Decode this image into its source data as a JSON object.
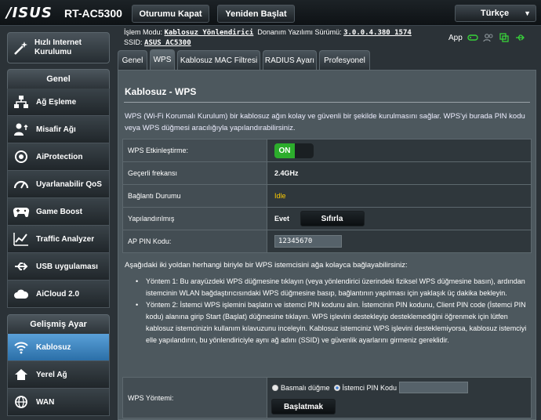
{
  "header": {
    "brand": "/ISUS",
    "model": "RT-AC5300",
    "logout_button": "Oturumu Kapat",
    "reboot_button": "Yeniden Başlat",
    "language": "Türkçe",
    "mode_label": "İşlem Modu:",
    "mode_value": "Kablosuz Yönlendirici",
    "firmware_label": "Donanım Yazılımı Sürümü:",
    "firmware_value": "3.0.0.4.380_1574",
    "ssid_label": "SSID:",
    "ssid_value": "ASUS_AC5300",
    "app_label": "App"
  },
  "sidebar": {
    "quick_setup": "Hızlı Internet Kurulumu",
    "general_title": "Genel",
    "general_items": [
      {
        "label": "Ağ Eşleme",
        "icon": "network-map-icon"
      },
      {
        "label": "Misafir Ağı",
        "icon": "guest-network-icon"
      },
      {
        "label": "AiProtection",
        "icon": "aiprotection-icon"
      },
      {
        "label": "Uyarlanabilir QoS",
        "icon": "qos-icon"
      },
      {
        "label": "Game Boost",
        "icon": "gamepad-icon"
      },
      {
        "label": "Traffic Analyzer",
        "icon": "traffic-analyzer-icon"
      },
      {
        "label": "USB uygulaması",
        "icon": "usb-icon"
      },
      {
        "label": "AiCloud 2.0",
        "icon": "cloud-icon"
      }
    ],
    "advanced_title": "Gelişmiş Ayar",
    "advanced_items": [
      {
        "label": "Kablosuz",
        "icon": "wireless-icon"
      },
      {
        "label": "Yerel Ağ",
        "icon": "lan-icon"
      },
      {
        "label": "WAN",
        "icon": "wan-icon"
      }
    ]
  },
  "tabs": [
    "Genel",
    "WPS",
    "Kablosuz MAC Filtresi",
    "RADIUS Ayarı",
    "Profesyonel"
  ],
  "active_tab": "WPS",
  "panel": {
    "title": "Kablosuz - WPS",
    "description": "WPS (Wi-Fi Korumalı Kurulum) bir kablosuz ağın kolay ve güvenli bir şekilde kurulmasını sağlar. WPS'yi burada PIN kodu veya WPS düğmesi aracılığıyla yapılandırabilirsiniz.",
    "rows": {
      "enable_label": "WPS Etkinleştirme:",
      "enable_value": "ON",
      "freq_label": "Geçerli frekansı",
      "freq_value": "2.4GHz",
      "status_label": "Bağlantı Durumu",
      "status_value": "Idle",
      "configured_label": "Yapılandırılmış",
      "configured_value": "Evet",
      "reset_button": "Sıfırla",
      "pin_label": "AP PIN Kodu:",
      "pin_value": "12345670"
    },
    "intro": "Aşağıdaki iki yoldan herhangi biriyle bir WPS istemcisini ağa kolayca bağlayabilirsiniz:",
    "method1": "Yöntem 1: Bu arayüzdeki WPS düğmesine tıklayın (veya yönlendirici üzerindeki fiziksel WPS düğmesine basın), ardından istemcinin WLAN bağdaştırıcısındaki WPS düğmesine basıp, bağlantının yapılması için yaklaşık üç dakika bekleyin.",
    "method2": "Yöntem 2: İstemci WPS işlemini başlatın ve istemci PIN kodunu alın. İstemcinin PIN kodunu, Client PIN code (İstemci PIN kodu) alanına girip Start (Başlat) düğmesine tıklayın. WPS işlevini destekleyip desteklemediğini öğrenmek için lütfen kablosuz istemcinizin kullanım kılavuzunu inceleyin. Kablosuz istemciniz WPS işlevini desteklemiyorsa, kablosuz istemciyi elle yapılandırın, bu yönlendiriciyle aynı ağ adını (SSID) ve güvenlik ayarlarını girmeniz gereklidir.",
    "wps_method_label": "WPS Yöntemi:",
    "option_push": "Basmalı düğme",
    "option_pin": "İstemci PIN Kodu",
    "start_button": "Başlatmak"
  },
  "colors": {
    "accent_green": "#2cad2c",
    "status_yellow": "#ffcc00",
    "active_blue": "#2b6fa8"
  }
}
